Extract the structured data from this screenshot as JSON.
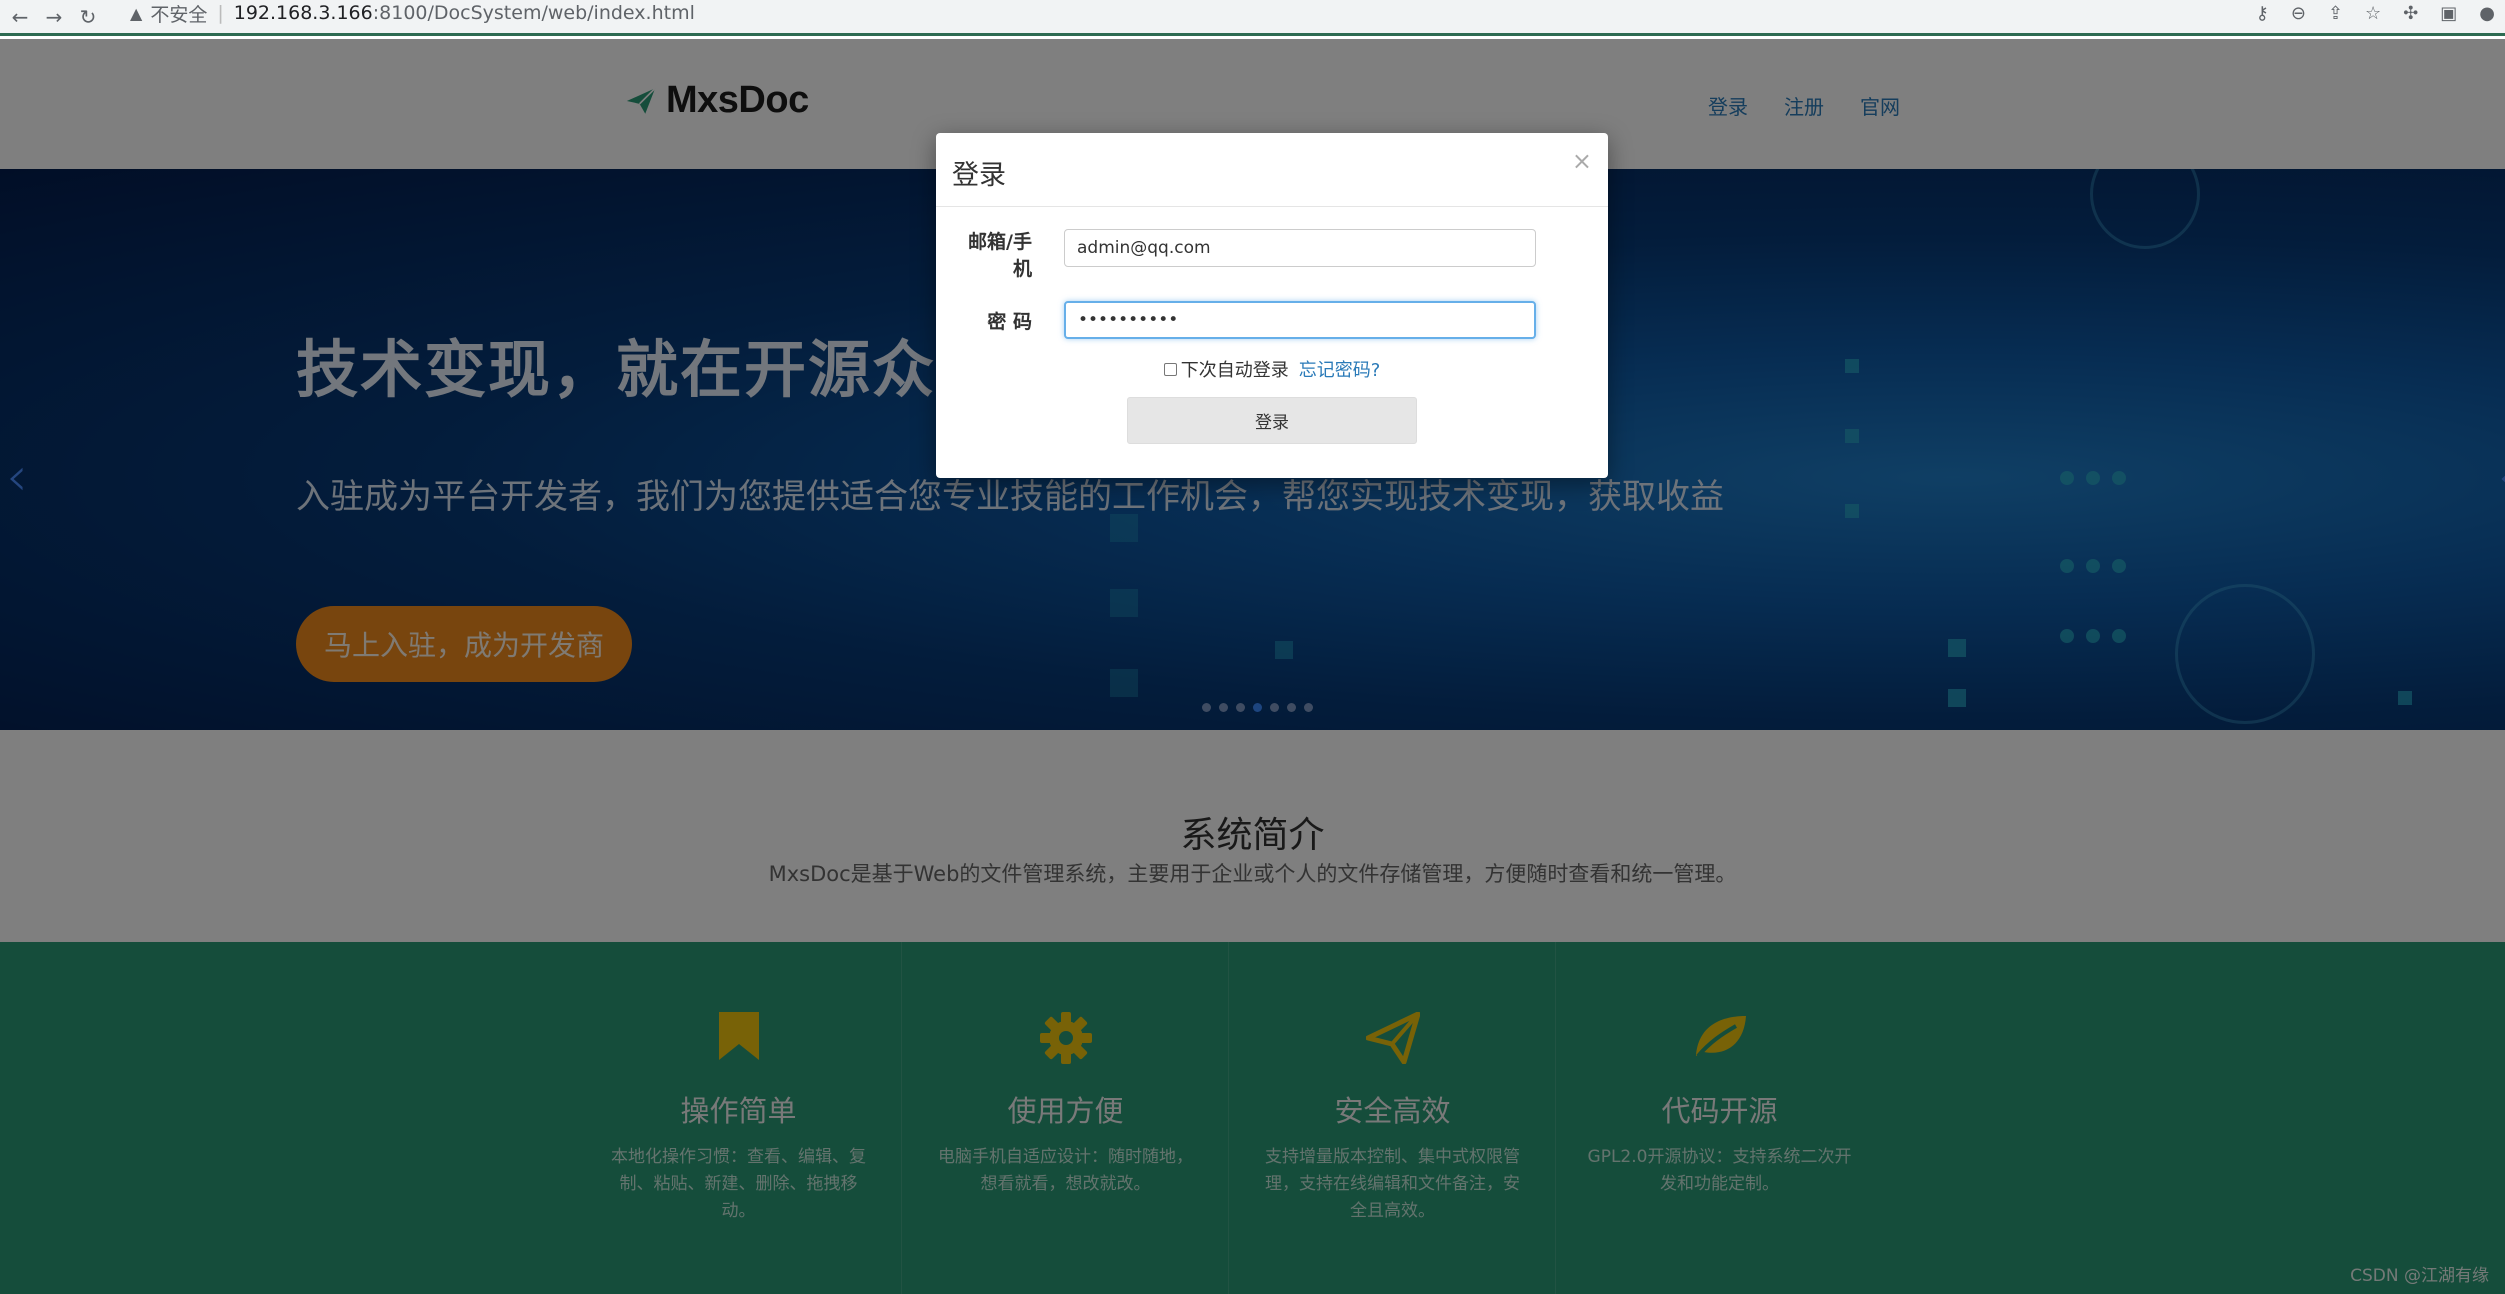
{
  "browser": {
    "insecure_label": "不安全",
    "url_host": "192.168.3.166",
    "url_rest": ":8100/DocSystem/web/index.html"
  },
  "header": {
    "brand": "MxsDoc",
    "nav": [
      "登录",
      "注册",
      "官网"
    ]
  },
  "hero": {
    "title": "技术变现，就在开源众包",
    "subtitle": "入驻成为平台开发者，我们为您提供适合您专业技能的工作机会，帮您实现技术变现，获取收益",
    "cta": "马上入驻，成为开发商",
    "carousel_dots": 7,
    "active_dot": 4
  },
  "intro": {
    "title": "系统简介",
    "description": "MxsDoc是基于Web的文件管理系统，主要用于企业或个人的文件存储管理，方便随时查看和统一管理。"
  },
  "features": [
    {
      "icon": "bookmark-icon",
      "title": "操作简单",
      "desc": "本地化操作习惯：查看、编辑、复制、粘贴、新建、删除、拖拽移动。"
    },
    {
      "icon": "gear-icon",
      "title": "使用方便",
      "desc": "电脑手机自适应设计：随时随地，想看就看，想改就改。"
    },
    {
      "icon": "paper-plane-icon",
      "title": "安全高效",
      "desc": "支持增量版本控制、集中式权限管理，支持在线编辑和文件备注，安全且高效。"
    },
    {
      "icon": "leaf-icon",
      "title": "代码开源",
      "desc": "GPL2.0开源协议：支持系统二次开发和功能定制。"
    }
  ],
  "watermark": "CSDN @江湖有缘",
  "login_modal": {
    "title": "登录",
    "close": "×",
    "email_label": "邮箱/手机",
    "email_value": "admin@qq.com",
    "password_label": "密 码",
    "password_value": "••••••••••",
    "remember_label": "下次自动登录",
    "forgot_link": "忘记密码?",
    "submit": "登录"
  },
  "colors": {
    "hero_bg": "#073a78",
    "cta": "#f08a1c",
    "feature_bg": "#2b9b77",
    "link": "#2a7ab8"
  }
}
